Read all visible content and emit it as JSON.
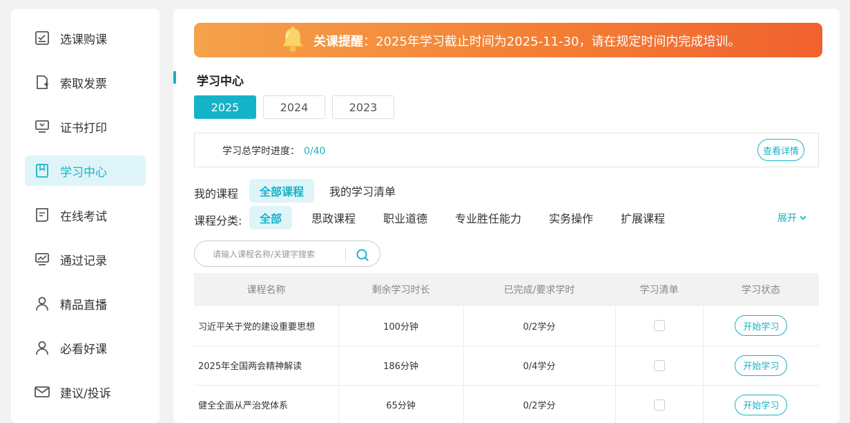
{
  "sidebar": {
    "items": [
      {
        "label": "选课购课",
        "icon": "checklist-icon"
      },
      {
        "label": "索取发票",
        "icon": "invoice-icon"
      },
      {
        "label": "证书打印",
        "icon": "monitor-print-icon"
      },
      {
        "label": "学习中心",
        "icon": "bookmark-book-icon",
        "active": true
      },
      {
        "label": "在线考试",
        "icon": "exam-paper-icon"
      },
      {
        "label": "通过记录",
        "icon": "chart-monitor-icon"
      },
      {
        "label": "精品直播",
        "icon": "user-icon"
      },
      {
        "label": "必看好课",
        "icon": "user-icon"
      },
      {
        "label": "建议/投诉",
        "icon": "mail-icon"
      }
    ]
  },
  "notice": {
    "title": "关课提醒",
    "message": "：2025年学习截止时间为2025-11-30，请在规定时间内完成培训。"
  },
  "section_title": "学习中心",
  "years": [
    "2025",
    "2024",
    "2023"
  ],
  "progress": {
    "label": "学习总学时进度：",
    "value": "0/40",
    "detail_button": "查看详情"
  },
  "my_courses": {
    "label": "我的课程",
    "tabs": [
      "全部课程",
      "我的学习清单"
    ]
  },
  "categories": {
    "label": "课程分类:",
    "items": [
      "全部",
      "思政课程",
      "职业道德",
      "专业胜任能力",
      "实务操作",
      "扩展课程"
    ],
    "expand": "展开"
  },
  "search": {
    "placeholder": "请输入课程名称/关键字搜索"
  },
  "table": {
    "headers": [
      "课程名称",
      "剩余学习时长",
      "已完成/要求学时",
      "学习清单",
      "学习状态"
    ],
    "rows": [
      {
        "name": "习近平关于党的建设重要思想",
        "remaining": "100分钟",
        "progress": "0/2学分",
        "action": "开始学习"
      },
      {
        "name": "2025年全国两会精神解读",
        "remaining": "186分钟",
        "progress": "0/4学分",
        "action": "开始学习"
      },
      {
        "name": "健全全面从严治党体系",
        "remaining": "65分钟",
        "progress": "0/2学分",
        "action": "开始学习"
      }
    ]
  },
  "colors": {
    "accent": "#15b3c7",
    "notice_start": "#f5a24a",
    "notice_end": "#f0612f"
  }
}
